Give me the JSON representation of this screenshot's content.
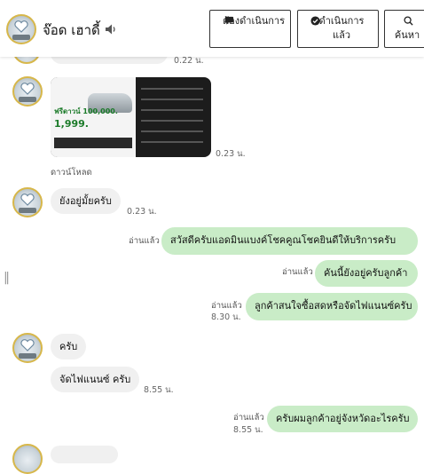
{
  "header": {
    "contact_name": "จ๊อด เฮาดี้",
    "buttons": {
      "pending": "ต้องดำเนินการ",
      "done": "ดำเนินการแล้ว",
      "search": "ค้นหา"
    }
  },
  "messages": {
    "top_time": "0.22 น.",
    "image_time": "0.23 น.",
    "download_label": "ดาวน์โหลด",
    "m1": {
      "text": "ยังอยู่มั้ยครับ",
      "time": "0.23 น."
    },
    "m2": {
      "read": "อ่านแล้ว",
      "text": "สวัสดีครับแอดมินแบงค์โชคคูณโชคยินดีให้บริการครับ"
    },
    "m3": {
      "read": "อ่านแล้ว",
      "text": "คันนี้ยังอยู่ครับลูกค้า"
    },
    "m4": {
      "read": "อ่านแล้ว",
      "time": "8.30 น.",
      "text": "ลูกค้าสนใจซื้อสดหรือจัดไฟแนนซ์ครับ"
    },
    "m5": {
      "text": "ครับ"
    },
    "m6": {
      "text": "จัดไฟแนนซ์ ครับ",
      "time": "8.55 น."
    },
    "m7": {
      "read": "อ่านแล้ว",
      "time": "8.55 น.",
      "text": "ครับผมลูกค้าอยู่จังหวัดอะไรครับ"
    }
  },
  "promo_image": {
    "headline": "ฟรีดาวน์ 100,000.",
    "price": "1,999."
  },
  "colors": {
    "incoming_bubble": "#f0f0f0",
    "outgoing_bubble": "#c9ecc7",
    "avatar_ring": "#d7b74a"
  },
  "icons": [
    "contact-avatar",
    "speaker-icon",
    "chat-bubble-icon",
    "check-circle-icon",
    "search-icon",
    "resize-handle-icon"
  ]
}
